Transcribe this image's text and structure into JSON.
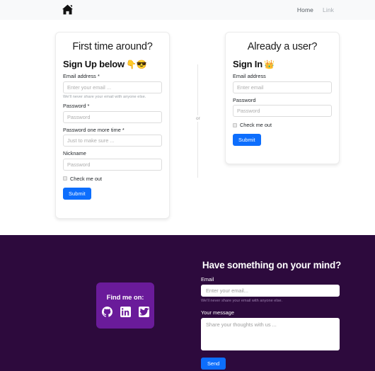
{
  "navbar": {
    "brand_icon": "home-icon",
    "links": [
      {
        "label": "Home",
        "state": "active"
      },
      {
        "label": "Link",
        "state": "muted"
      }
    ]
  },
  "signup_card": {
    "title": "First time around?",
    "heading": "Sign Up below",
    "heading_emoji": "👇😎",
    "fields": [
      {
        "label": "Email address *",
        "placeholder": "Enter your email ...",
        "value": "",
        "help": "We'll never share your email with anyone else."
      },
      {
        "label": "Password *",
        "placeholder": "Password",
        "value": "",
        "help": ""
      },
      {
        "label": "Password one more time *",
        "placeholder": "Just to make sure ...",
        "value": "",
        "help": ""
      },
      {
        "label": "Nickname",
        "placeholder": "Password",
        "value": "",
        "help": ""
      }
    ],
    "checkbox_label": "Check me out",
    "submit_label": "Submit"
  },
  "divider": {
    "text": "or"
  },
  "signin_card": {
    "title": "Already a user?",
    "heading": "Sign In",
    "heading_emoji": "👑",
    "fields": [
      {
        "label": "Email address",
        "placeholder": "Enter email",
        "value": ""
      },
      {
        "label": "Password",
        "placeholder": "Password",
        "value": ""
      }
    ],
    "checkbox_label": "Check me out",
    "submit_label": "Submit"
  },
  "footer": {
    "title": "Have something on your mind?",
    "email_label": "Email",
    "email_placeholder": "Enter your email...",
    "email_value": "",
    "email_help": "We'll never share your email with anyone else.",
    "message_label": "Your message",
    "message_placeholder": "Share your thoughts with us ...",
    "message_value": "",
    "send_label": "Send",
    "social": {
      "title": "Find me on:",
      "icons": [
        "github-icon",
        "linkedin-icon",
        "twitter-icon"
      ]
    }
  },
  "colors": {
    "navbar_bg": "#f8f9fa",
    "primary_button": "#0d6efd",
    "footer_bg": "#2d0a3d",
    "social_card_bg": "#6a1b9a",
    "card_bg": "#ffffff"
  }
}
